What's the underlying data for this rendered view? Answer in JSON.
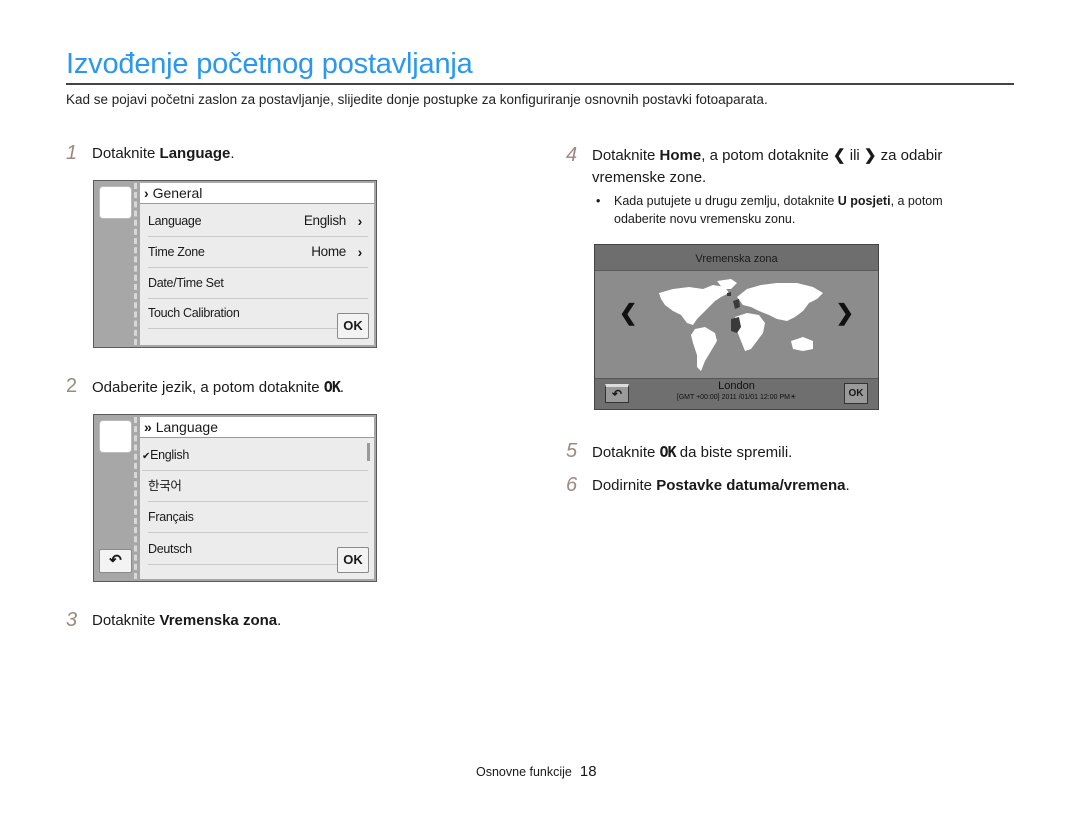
{
  "page": {
    "title": "Izvođenje početnog postavljanja",
    "intro": "Kad se pojavi početni zaslon za postavljanje, slijedite donje postupke za konfiguriranje osnovnih postavki fotoaparata."
  },
  "steps": [
    {
      "num": "1",
      "pre": "Dotaknite ",
      "bold": "Language",
      "post": "."
    },
    {
      "num": "2",
      "pre": "Odaberite jezik, a potom dotaknite ",
      "ok": "OK",
      "post": "."
    },
    {
      "num": "3",
      "pre": "Dotaknite ",
      "bold": "Vremenska zona",
      "post": "."
    },
    {
      "num": "4",
      "pre": "Dotaknite ",
      "bold": "Home",
      "mid": ", a potom dotaknite ",
      "left": "❮",
      "ili": " ili ",
      "right": "❯",
      "post": " za odabir",
      "line2": "vremenske zone."
    },
    {
      "num": "5",
      "pre": "Dotaknite ",
      "ok": "OK",
      "post": " da biste spremili."
    },
    {
      "num": "6",
      "pre": "Dodirnite ",
      "bold": "Postavke datuma/vremena",
      "post": "."
    }
  ],
  "bullet": {
    "symbol": "•",
    "pre": "Kada putujete u drugu zemlju, dotaknite ",
    "bold": "U posjeti",
    "post": ", a potom",
    "line2": "odaberite novu vremensku zonu."
  },
  "screen_general": {
    "header_icon": "›",
    "header": "General",
    "rows": [
      {
        "label": "Language",
        "value": "English",
        "chevron": "›"
      },
      {
        "label": "Time Zone",
        "value": "Home",
        "chevron": "›"
      },
      {
        "label": "Date/Time Set",
        "value": "",
        "chevron": ""
      },
      {
        "label": "Touch Calibration",
        "value": "",
        "chevron": ""
      }
    ],
    "ok_label": "OK"
  },
  "screen_language": {
    "header_icon": "»",
    "header": "Language",
    "rows": [
      {
        "label": "English",
        "selected": true,
        "check": "✔"
      },
      {
        "label": "한국어",
        "selected": false,
        "check": ""
      },
      {
        "label": "Français",
        "selected": false,
        "check": ""
      },
      {
        "label": "Deutsch",
        "selected": false,
        "check": ""
      }
    ],
    "back_icon": "↶",
    "ok_label": "OK"
  },
  "screen_timezone": {
    "header": "Vremenska zona",
    "prev_icon": "❮",
    "next_icon": "❯",
    "city": "London",
    "info": "[GMT +00:00] 2011 /01/01 12:00 PM",
    "dst_icon": "☀",
    "back_icon": "↶",
    "ok_label": "OK",
    "colors": {
      "land": "#ffffff",
      "selected_zone": "#3a3a3a",
      "background": "#8c8c8c"
    }
  },
  "footer": {
    "section": "Osnovne funkcije",
    "page_number": "18"
  }
}
